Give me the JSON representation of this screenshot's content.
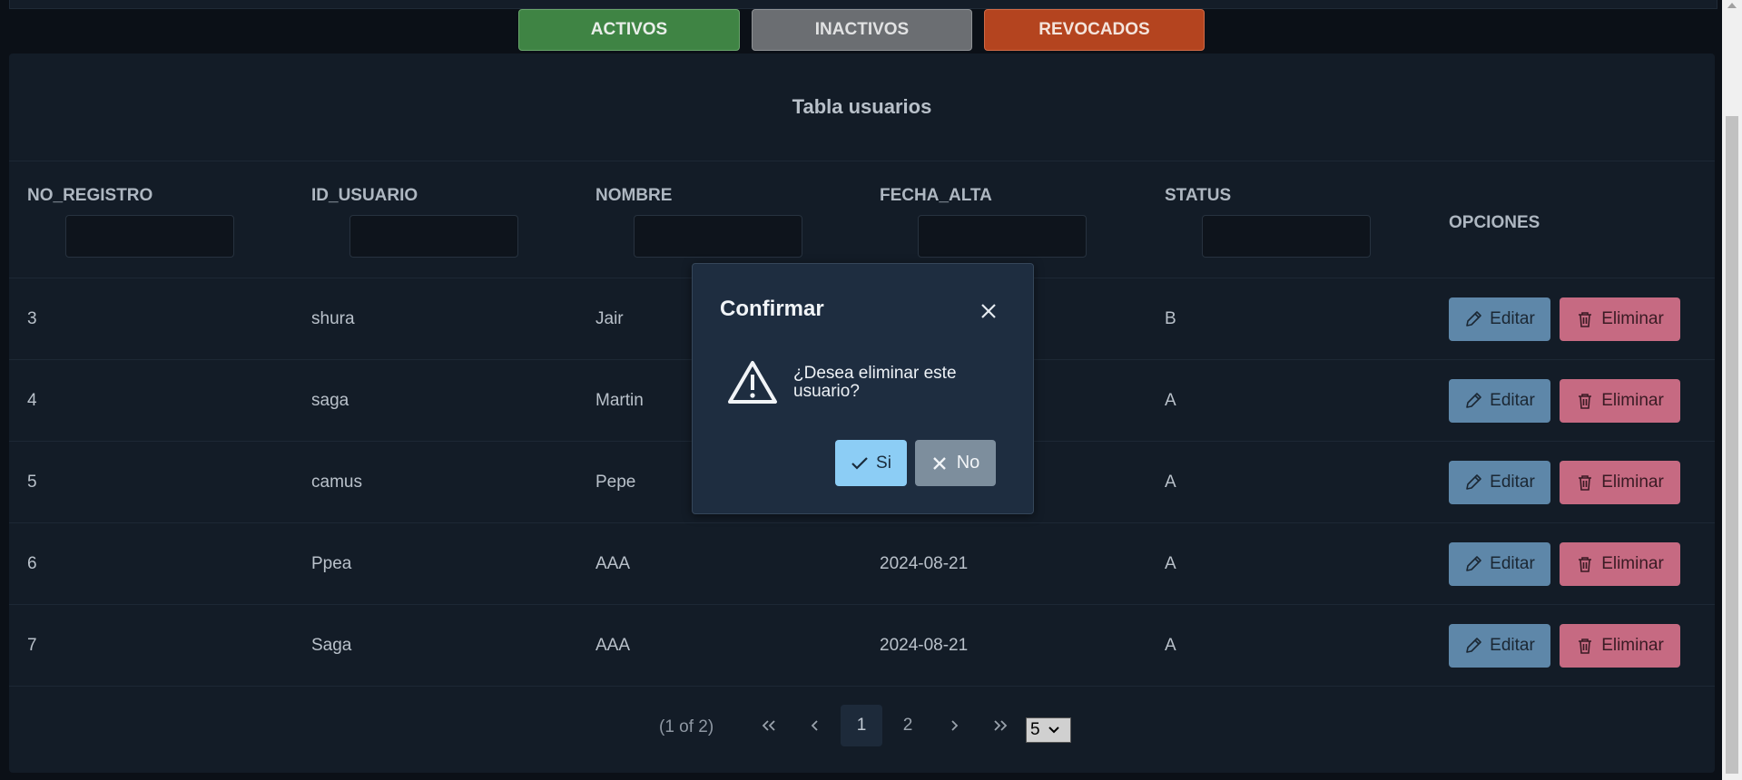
{
  "filters": {
    "active_label": "ACTIVOS",
    "inactive_label": "INACTIVOS",
    "revoked_label": "REVOCADOS"
  },
  "table": {
    "title": "Tabla usuarios",
    "columns": [
      "NO_REGISTRO",
      "ID_USUARIO",
      "NOMBRE",
      "FECHA_ALTA",
      "STATUS",
      "OPCIONES"
    ],
    "rows": [
      {
        "no_registro": "3",
        "id_usuario": "shura",
        "nombre": "Jair",
        "fecha_alta": "",
        "status": "B"
      },
      {
        "no_registro": "4",
        "id_usuario": "saga",
        "nombre": "Martin",
        "fecha_alta": "",
        "status": "A"
      },
      {
        "no_registro": "5",
        "id_usuario": "camus",
        "nombre": "Pepe",
        "fecha_alta": "",
        "status": "A"
      },
      {
        "no_registro": "6",
        "id_usuario": "Ppea",
        "nombre": "AAA",
        "fecha_alta": "2024-08-21",
        "status": "A"
      },
      {
        "no_registro": "7",
        "id_usuario": "Saga",
        "nombre": "AAA",
        "fecha_alta": "2024-08-21",
        "status": "A"
      }
    ],
    "edit_label": "Editar",
    "delete_label": "Eliminar"
  },
  "paginator": {
    "info": "(1 of 2)",
    "first": "«",
    "prev": "‹",
    "pages": [
      "1",
      "2"
    ],
    "current_page": "1",
    "next": "›",
    "last": "»",
    "rows_per_page": "5"
  },
  "dialog": {
    "title": "Confirmar",
    "message": "¿Desea eliminar este usuario?",
    "yes_label": "Si",
    "no_label": "No"
  },
  "icons": {
    "edit": "pencil-icon",
    "delete": "trash-icon",
    "close": "close-icon",
    "warning": "warning-icon",
    "yes": "check-icon",
    "no": "x-icon"
  },
  "colors": {
    "active": "#3f8444",
    "inactive": "#6b6e72",
    "revoked": "#b4441f",
    "edit": "#5e87a9",
    "delete": "#c66a82",
    "yes": "#8ccdf5",
    "no": "#7d8e9d"
  }
}
